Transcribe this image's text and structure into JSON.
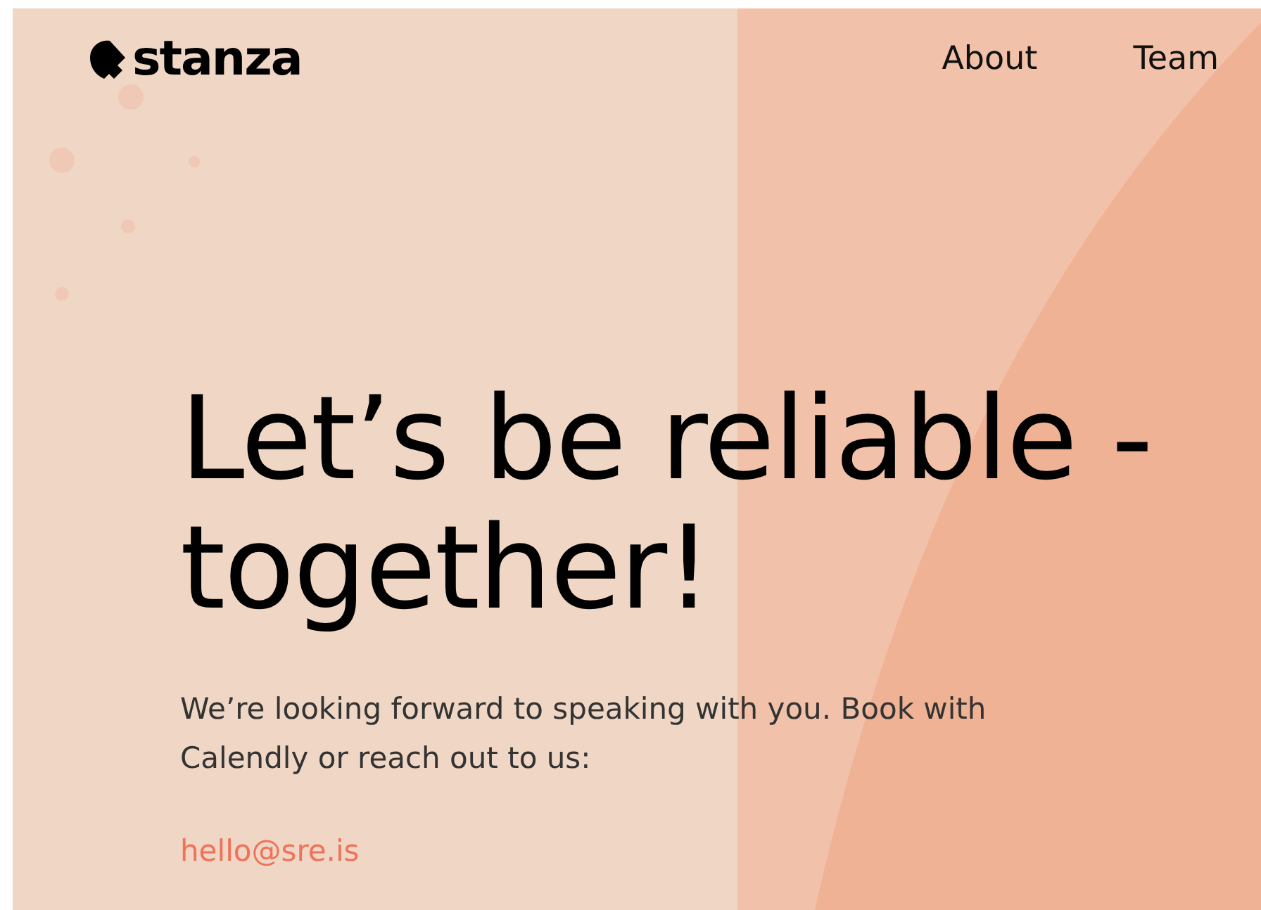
{
  "header": {
    "logo": "stanza",
    "nav": [
      {
        "label": "About"
      },
      {
        "label": "Team"
      }
    ]
  },
  "hero": {
    "title": "Let’s be reliable - together!",
    "text": "We’re looking forward to speaking with you. Book with Calendly or reach out to us:",
    "email": "hello@sre.is"
  }
}
